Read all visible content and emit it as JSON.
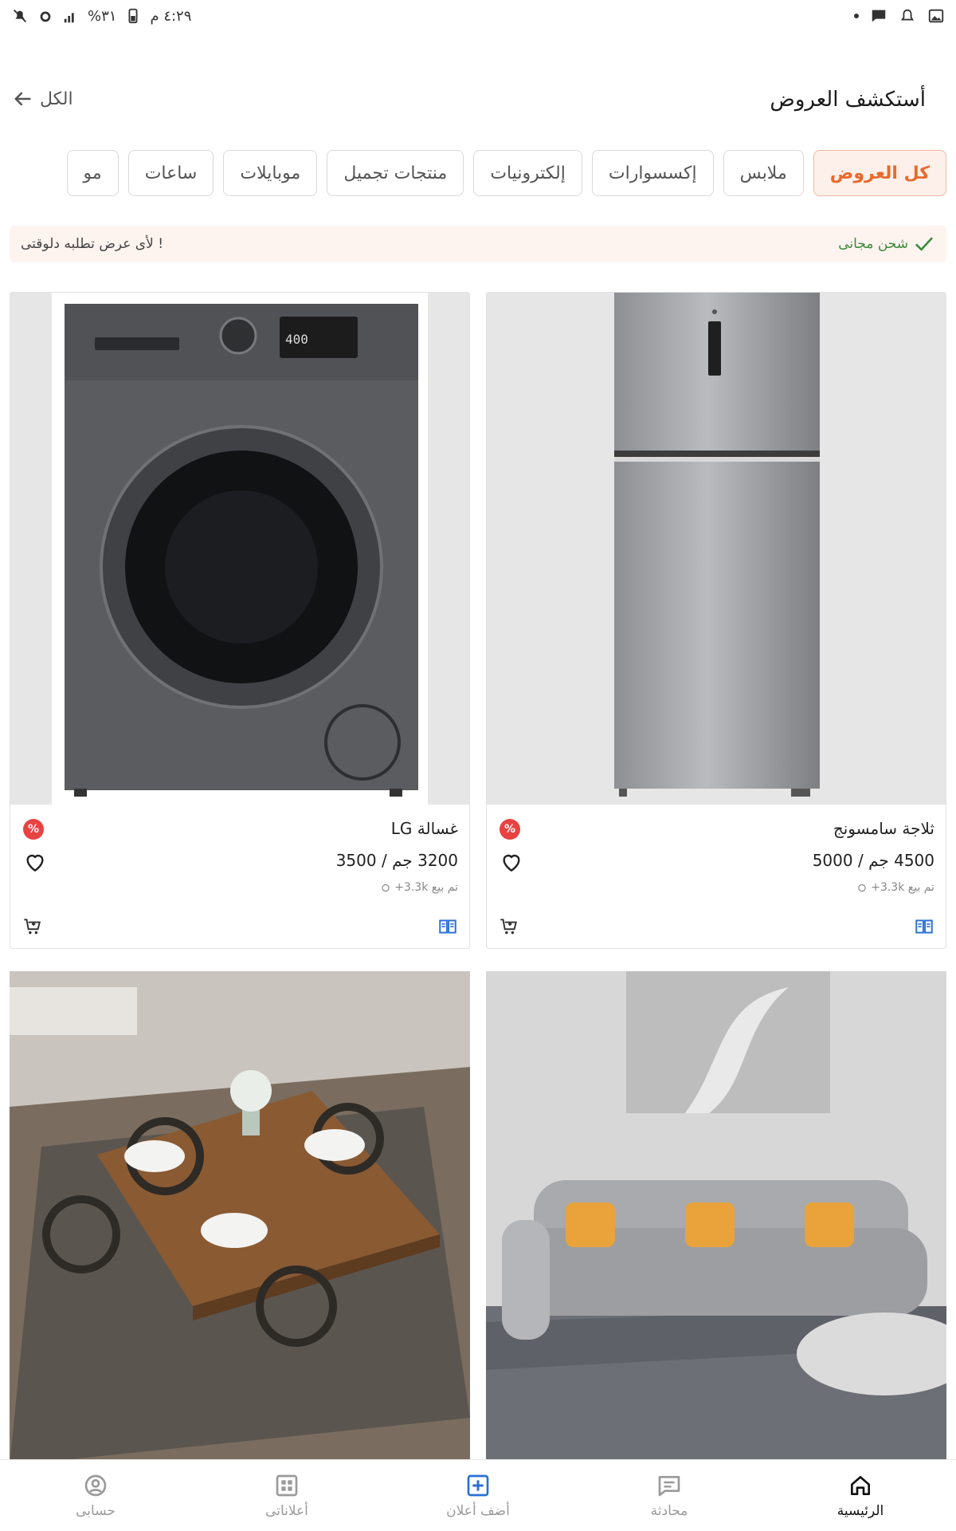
{
  "status_bar": {
    "time": "٤:٢٩ م",
    "battery": "٣١%"
  },
  "header": {
    "title": "أستكشف العروض",
    "all_label": "الكل"
  },
  "categories": [
    {
      "label": "كل العروض",
      "active": true
    },
    {
      "label": "ملابس",
      "active": false
    },
    {
      "label": "إكسسوارات",
      "active": false
    },
    {
      "label": "إلكترونيات",
      "active": false
    },
    {
      "label": "منتجات تجميل",
      "active": false
    },
    {
      "label": "موبايلات",
      "active": false
    },
    {
      "label": "ساعات",
      "active": false
    },
    {
      "label": "مو",
      "active": false
    }
  ],
  "promo": {
    "free_shipping": "شحن مجانى",
    "order_now": "لأى عرض تطلبه دلوقتى !"
  },
  "products": [
    {
      "name": "ثلاجة سامسونج",
      "price": "4500 جم / 5000",
      "sold": "تم بيع 3.3k+",
      "badge": "%",
      "image": "refrigerator"
    },
    {
      "name": "غسالة LG",
      "price": "3200 جم / 3500",
      "sold": "تم بيع 3.3k+",
      "badge": "%",
      "image": "washing-machine"
    },
    {
      "name": "",
      "image": "sofa"
    },
    {
      "name": "",
      "image": "dining-table"
    }
  ],
  "bottom_nav": [
    {
      "label": "الرئيسية",
      "icon": "home-icon",
      "active": true
    },
    {
      "label": "محادثة",
      "icon": "chat-icon",
      "active": false
    },
    {
      "label": "أضف أعلان",
      "icon": "add-ad-icon",
      "active": false
    },
    {
      "label": "أعلاناتى",
      "icon": "grid-icon",
      "active": false
    },
    {
      "label": "حسابى",
      "icon": "account-icon",
      "active": false
    }
  ],
  "colors": {
    "accent": "#e8692d",
    "active_chip_bg": "#fdf0ea",
    "promo_bg": "#fdf3ef",
    "sale_badge": "#e84242",
    "shipping_green": "#3a8a3a",
    "compare_blue": "#2a6fd6"
  }
}
